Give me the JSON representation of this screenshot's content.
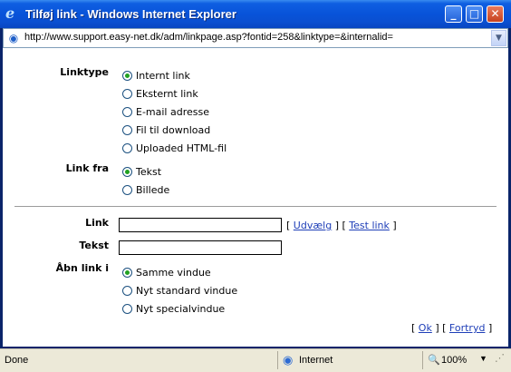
{
  "window": {
    "title": "Tilføj link - Windows Internet Explorer",
    "address": "http://www.support.easy-net.dk/adm/linkpage.asp?fontid=258&linktype=&internalid=",
    "controls": {
      "minimize": "_",
      "maximize": "□",
      "close": "✕"
    }
  },
  "form": {
    "linktype_label": "Linktype",
    "linktype_options": [
      "Internt link",
      "Eksternt link",
      "E-mail adresse",
      "Fil til download",
      "Uploaded HTML-fil"
    ],
    "linktype_selected": "Internt link",
    "linkfra_label": "Link fra",
    "linkfra_options": [
      "Tekst",
      "Billede"
    ],
    "linkfra_selected": "Tekst",
    "link_label": "Link",
    "link_value": "",
    "link_actions": {
      "open1": "[",
      "select": "Udvælg",
      "mid": "] [",
      "test": "Test link",
      "close1": "]"
    },
    "tekst_label": "Tekst",
    "tekst_value": "",
    "aabn_label": "Åbn link i",
    "aabn_options": [
      "Samme vindue",
      "Nyt standard vindue",
      "Nyt specialvindue"
    ],
    "aabn_selected": "Samme vindue",
    "footer": {
      "open1": "[",
      "ok": "Ok",
      "mid": "] [",
      "cancel": "Fortryd",
      "close1": "]"
    }
  },
  "statusbar": {
    "status": "Done",
    "zone": "Internet",
    "zoom": "100%"
  }
}
